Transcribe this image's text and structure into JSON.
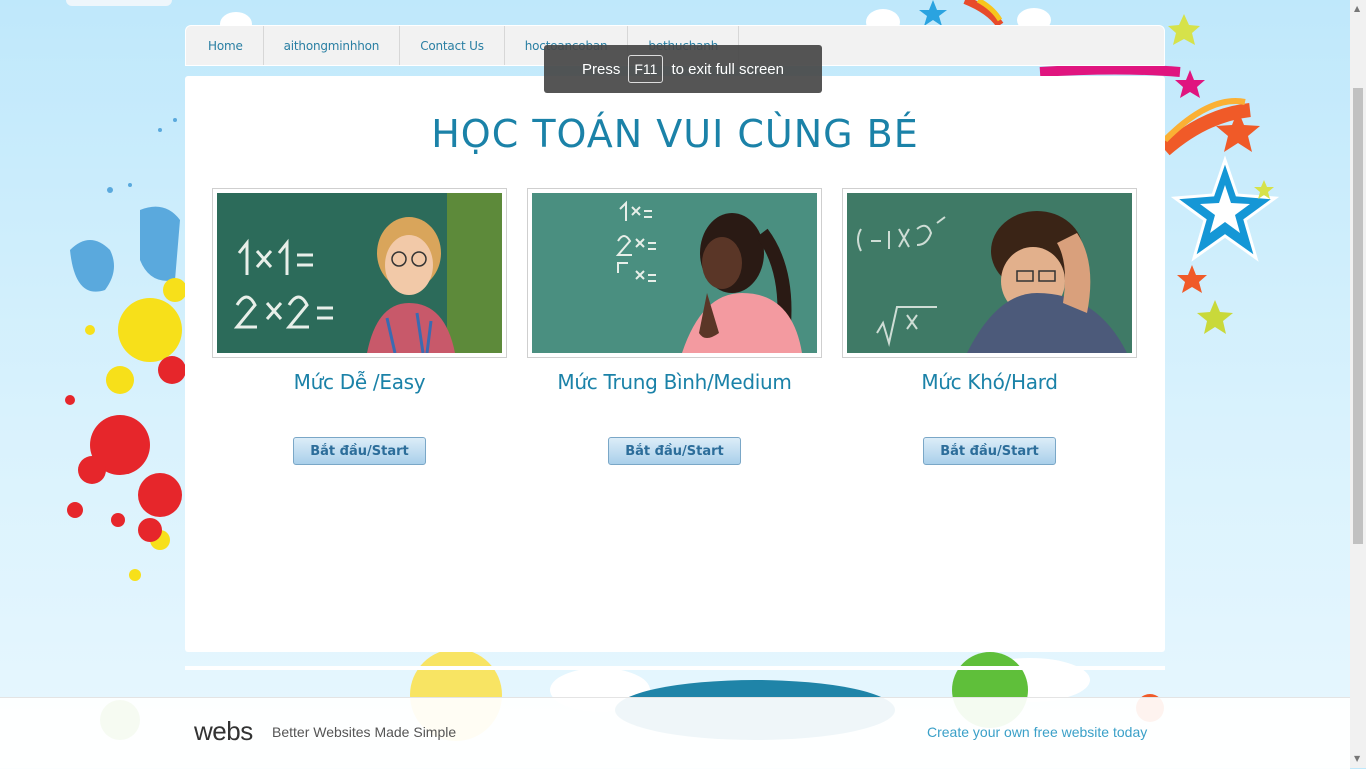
{
  "nav": {
    "items": [
      "Home",
      "aithongminhhon",
      "Contact Us",
      "hoctoancoban",
      "bethuchanh"
    ]
  },
  "main": {
    "title": "HỌC TOÁN VUI CÙNG BÉ",
    "cards": [
      {
        "label": "Mức Dễ /Easy",
        "button": "Bắt đầu/Start",
        "photo": "boy-at-chalkboard-photo"
      },
      {
        "label": "Mức Trung Bình/Medium",
        "button": "Bắt đầu/Start",
        "photo": "girl-thinking-at-chalkboard-photo"
      },
      {
        "label": "Mức Khó/Hard",
        "button": "Bắt đầu/Start",
        "photo": "boy-frustrated-at-chalkboard-photo"
      }
    ]
  },
  "toast": {
    "before": "Press",
    "key": "F11",
    "after": "to exit full screen"
  },
  "footer": {
    "logo": "webs",
    "tagline": "Better Websites Made Simple",
    "cta": "Create your own free website today"
  },
  "colors": {
    "accent": "#1b82a8",
    "button": "#a9cfea",
    "background": "#bfe8fb"
  }
}
